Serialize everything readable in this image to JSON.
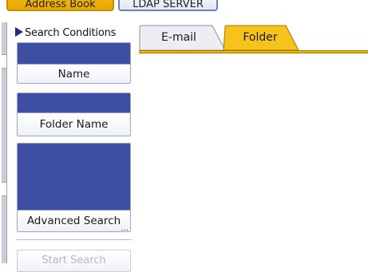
{
  "top_tabs": [
    {
      "label": "Address Book",
      "selected": true
    },
    {
      "label": "LDAP SERVER",
      "selected": false
    }
  ],
  "search_panel": {
    "title": "Search Conditions",
    "name_button": "Name",
    "folder_name_button": "Folder Name",
    "advanced_search_button": "Advanced Search",
    "advanced_more_indicator": "...",
    "start_search_button": "Start Search"
  },
  "result_tabs": [
    {
      "label": "E-mail",
      "selected": false
    },
    {
      "label": "Folder",
      "selected": true
    }
  ],
  "colors": {
    "accent_yellow": "#f2b600",
    "field_blue": "#3d4ea3",
    "disabled_text": "#b4b8c2"
  }
}
